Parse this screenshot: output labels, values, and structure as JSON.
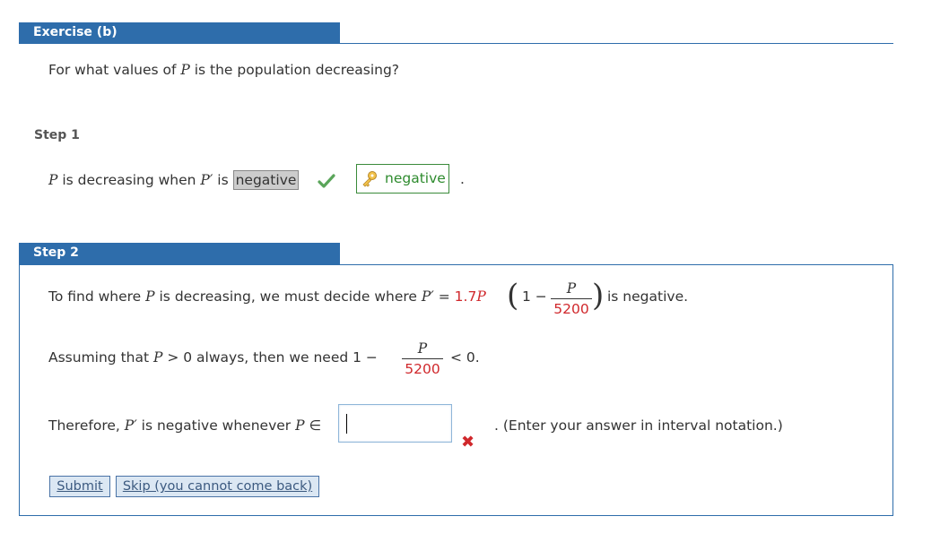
{
  "exercise": {
    "header": "Exercise (b)",
    "question_pre": "For what values of ",
    "question_var": "P",
    "question_post": " is the population decreasing?"
  },
  "step1": {
    "label": "Step 1",
    "text_pre": " is decreasing when ",
    "var_p": "P",
    "var_pprime": "P′",
    "text_is": " is ",
    "selected_value": "negative",
    "answer_value": "negative",
    "period": "."
  },
  "step2": {
    "label": "Step 2",
    "line1_pre": "To find where ",
    "line1_mid": " is decreasing, we must decide where ",
    "line1_eq": " = ",
    "coef": "1.7",
    "open_paren": "(",
    "one_minus": "1 −",
    "frac_num": "P",
    "frac_den": "5200",
    "close_paren": ")",
    "line1_post": "is negative.",
    "line2_pre": "Assuming that ",
    "line2_cond": " > 0 always, then we need 1 −",
    "line2_post": "< 0.",
    "line3_pre": "Therefore, ",
    "line3_mid": " is negative whenever ",
    "element_of": " ∈",
    "input_value": "",
    "line3_post": ". (Enter your answer in interval notation.)",
    "wrong_mark": "✖"
  },
  "buttons": {
    "submit": "Submit",
    "skip": "Skip (you cannot come back)"
  },
  "colors": {
    "header_blue": "#2e6dab",
    "error_red": "#d0282c",
    "correct_green": "#2e8b2e"
  }
}
